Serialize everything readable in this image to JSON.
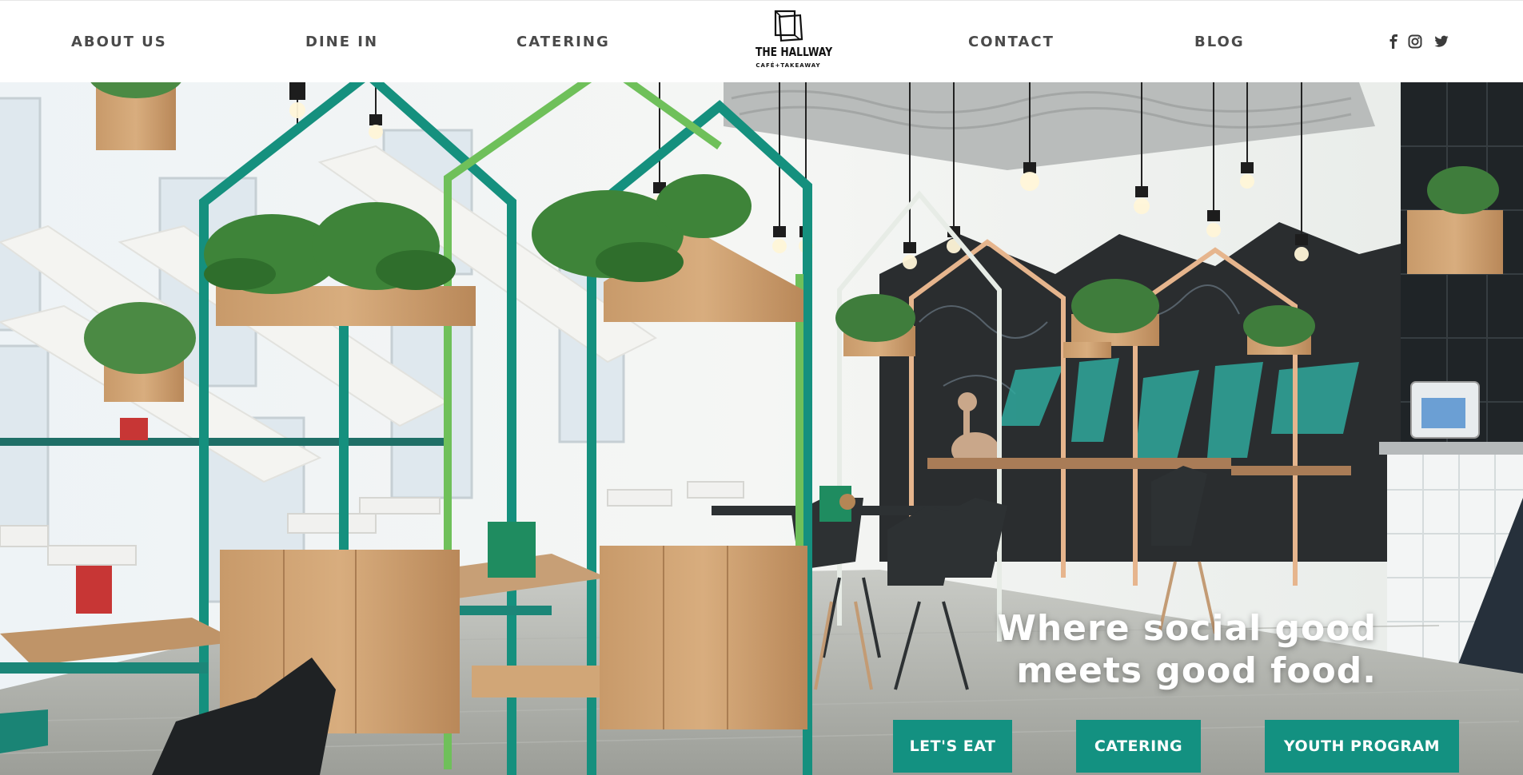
{
  "nav": {
    "about": "ABOUT US",
    "dine_in": "DINE IN",
    "catering": "CATERING",
    "contact": "CONTACT",
    "blog": "BLOG"
  },
  "logo": {
    "title": "THE HALLWAY",
    "subtitle": "CAFÉ+TAKEAWAY"
  },
  "social": {
    "icons": [
      "facebook-icon",
      "instagram-icon",
      "twitter-icon"
    ]
  },
  "hero": {
    "headline_line1": "Where social good",
    "headline_line2": "meets good food.",
    "buttons": {
      "lets_eat": "LET'S EAT",
      "catering": "CATERING",
      "youth_program": "YOUTH PROGRAM"
    }
  },
  "colors": {
    "accent": "#139181",
    "nav_text": "#4a4a4a",
    "headline": "#ffffff"
  }
}
